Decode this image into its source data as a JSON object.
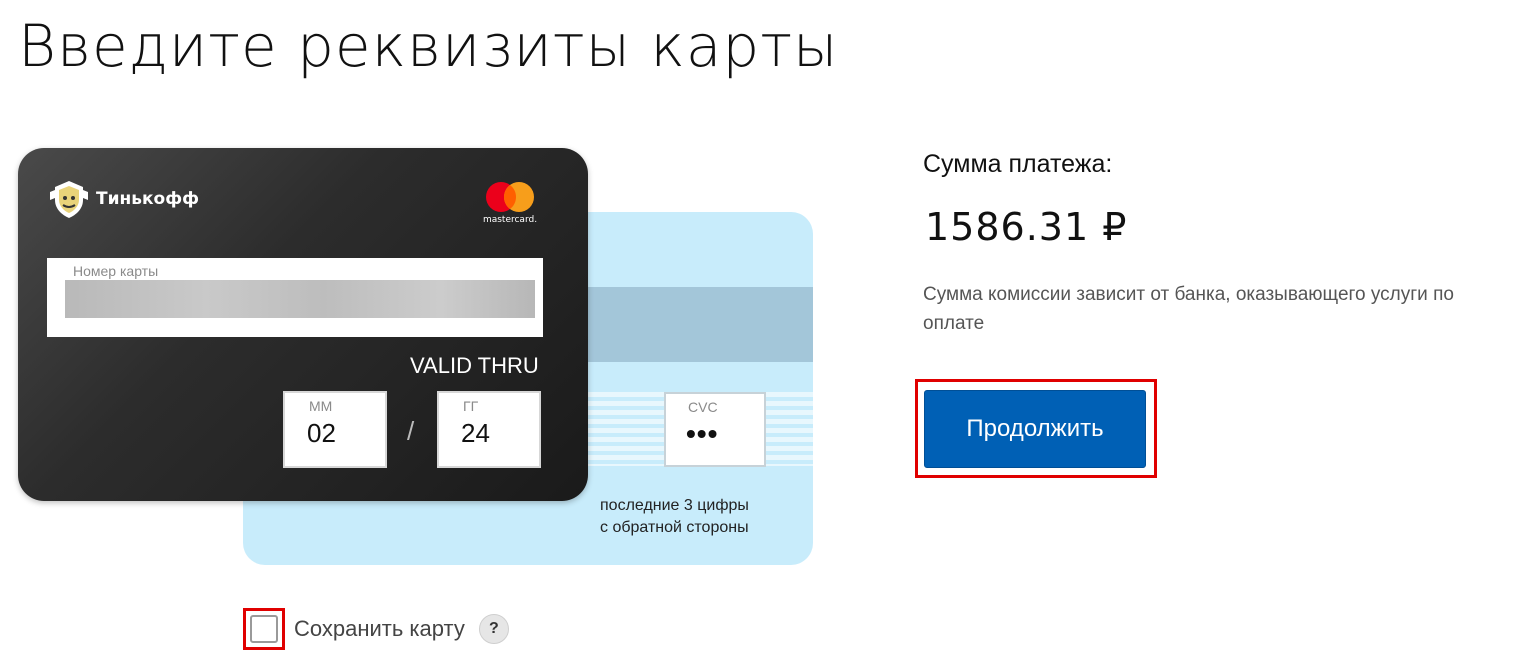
{
  "page": {
    "title": "Введите реквизиты карты"
  },
  "card_front": {
    "bank_name": "Тинькофф",
    "network_name": "mastercard.",
    "card_number_label": "Номер карты",
    "valid_thru": "VALID THRU",
    "month_label": "ММ",
    "month_value": "02",
    "year_label": "ГГ",
    "year_value": "24",
    "separator": "/"
  },
  "card_back": {
    "cvc_label": "CVC",
    "cvc_value": "•••",
    "cvc_hint_line1": "последние 3 цифры",
    "cvc_hint_line2": "с обратной стороны"
  },
  "save_card": {
    "label": "Сохранить карту",
    "help": "?"
  },
  "payment": {
    "amount_label": "Сумма платежа:",
    "amount_value": "1586.31 ₽",
    "commission_note": "Сумма комиссии зависит от банка, оказывающего услуги по оплате",
    "continue_label": "Продолжить"
  },
  "colors": {
    "primary_button": "#0060b5",
    "highlight": "#e00000",
    "card_back": "#c8ecfb",
    "card_front": "#2c2c2c"
  },
  "icons": {
    "bank_logo": "tinkoff-emblem-icon",
    "network_logo": "mastercard-icon",
    "help": "question-icon"
  }
}
